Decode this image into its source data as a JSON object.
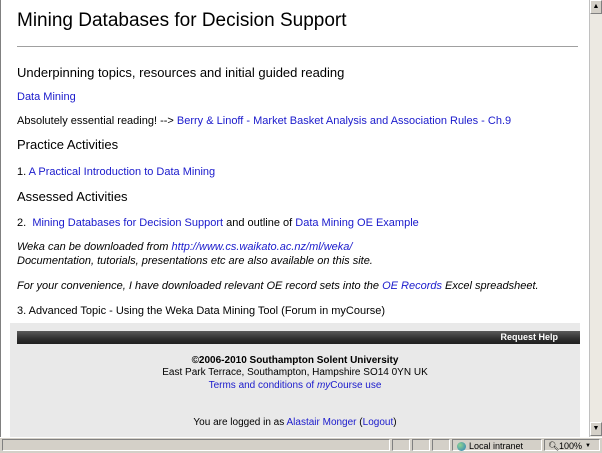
{
  "page": {
    "title": "Mining Databases for Decision Support",
    "section1_heading": "Underpinning topics, resources and initial guided reading",
    "data_mining_link": "Data Mining",
    "reading_prefix": "Absolutely essential reading! -->",
    "reading_link": "Berry & Linoff - Market Basket Analysis and Association Rules - Ch.9",
    "practice_heading": "Practice Activities",
    "practice_num": "1.",
    "practice_link": "A Practical Introduction to Data Mining",
    "assessed_heading": "Assessed Activities",
    "assessed_num": "2.",
    "assessed_link": "Mining Databases for Decision Support",
    "assessed_mid": "and outline of",
    "assessed_link2": "Data Mining OE Example",
    "weka_prefix": "Weka can be downloaded from",
    "weka_link": "http://www.cs.waikato.ac.nz/ml/weka/",
    "weka_line2": "Documentation, tutorials, presentations etc are also available on this site.",
    "oe_prefix": "For your convenience, I have downloaded relevant OE record sets into the",
    "oe_link": "OE Records",
    "oe_suffix": "Excel spreadsheet.",
    "advanced": "3. Advanced Topic - Using the Weka Data Mining Tool (Forum in myCourse)"
  },
  "footer": {
    "help_label": "Request Help",
    "copyright": "©2006-2010 Southampton Solent University",
    "address": "East Park Terrace, Southampton, Hampshire SO14 0YN UK",
    "terms_prefix": "Terms and conditions of ",
    "terms_my": "my",
    "terms_suffix": "Course use",
    "logged_prefix": "You are logged in as",
    "user_name": "Alastair Monger",
    "logout_open": "(",
    "logout": "Logout",
    "logout_close": ")"
  },
  "statusbar": {
    "zone": "Local intranet",
    "zoom": "100%",
    "zoom_icon": "magnifier-icon",
    "zone_icon": "globe-icon"
  },
  "colors": {
    "link": "#1a1acc",
    "help_bar": "#2e2e2e",
    "footer_bg": "#e9e9e9"
  }
}
